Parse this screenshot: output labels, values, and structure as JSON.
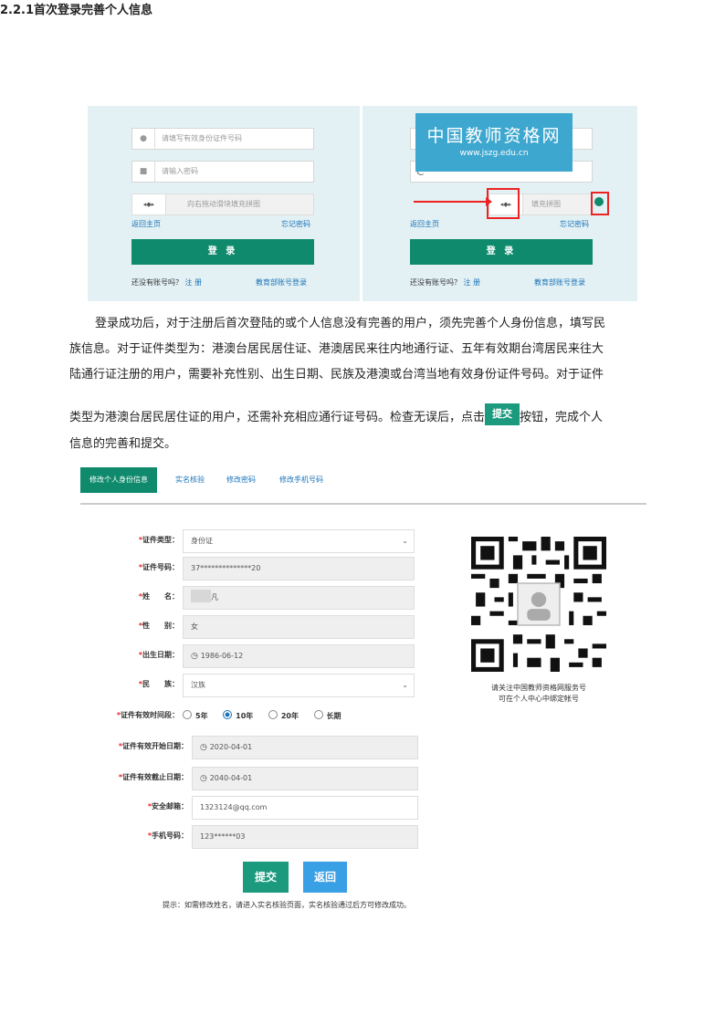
{
  "heading": "2.2.1首次登录完善个人信息",
  "login_left": {
    "id_placeholder": "请填写有效身份证件号码",
    "password_placeholder": "请输入密码",
    "slider_knob": "◂◆▸",
    "slider_text": "向右拖动滑块填充拼图",
    "back_home": "返回主页",
    "forgot": "忘记密码",
    "login_button": "登 录",
    "no_account": "还没有账号吗？",
    "register": "注 册",
    "edu_login": "教育部账号登录"
  },
  "login_right": {
    "logo_cn": "中国教师资格网",
    "logo_url": "www.jszg.edu.cn",
    "refresh_icon": "C",
    "slider_knob": "◂◆▸",
    "slider_text": "填充拼图",
    "back_home": "返回主页",
    "forgot": "忘记密码",
    "login_button": "登 录",
    "no_account": "还没有账号吗？",
    "register": "注 册",
    "edu_login": "教育部账号登录"
  },
  "paragraph": {
    "line1": "登录成功后，对于注册后首次登陆的或个人信息没有完善的用户，须先完善个人身份信息，填写民",
    "line2": "族信息。对于证件类型为：港澳台居民居住证、港澳居民来往内地通行证、五年有效期台湾居民来往大",
    "line3": "陆通行证注册的用户，需要补充性别、出生日期、民族及港澳或台湾当地有效身份证件号码。对于证件",
    "line4_pre": "类型为港澳台居民居住证的用户，还需补充相应通行证号码。检查无误后，点击",
    "submit_inline": "提交",
    "line4_post": "按钮，完成个人",
    "line5": "信息的完善和提交。"
  },
  "tabs": [
    "修改个人身份信息",
    "实名核验",
    "修改密码",
    "修改手机号码"
  ],
  "form": {
    "id_type_label": "证件类型：",
    "id_type_value": "身份证",
    "id_no_label": "证件号码：",
    "id_no_value": "37**************20",
    "name_label": "姓　　名：",
    "name_value": "凡",
    "gender_label": "性　　别：",
    "gender_value": "女",
    "birth_label": "出生日期：",
    "birth_value": "1986-06-12",
    "ethnic_label": "民　　族：",
    "ethnic_value": "汉族",
    "validity_label": "证件有效时间段：",
    "validity_options": [
      "5年",
      "10年",
      "20年",
      "长期"
    ],
    "validity_selected": "10年",
    "start_label": "证件有效开始日期：",
    "start_value": "2020-04-01",
    "end_label": "证件有效截止日期：",
    "end_value": "2040-04-01",
    "email_label": "安全邮箱：",
    "email_value": "1323124@qq.com",
    "phone_label": "手机号码：",
    "phone_value": "123******03",
    "submit": "提交",
    "back": "返回",
    "tip": "提示：如需修改姓名，请进入实名核验页面，实名核验通过后方可修改成功。"
  },
  "qr_caption_1": "请关注中国教师资格网服务号",
  "qr_caption_2": "可在个人中心中绑定帐号"
}
